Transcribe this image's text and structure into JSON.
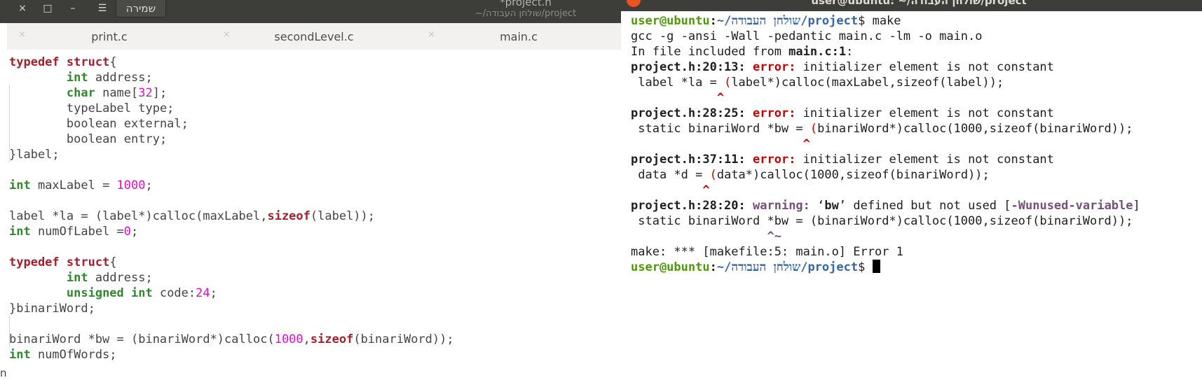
{
  "editor": {
    "title": "*project.h",
    "subtitle": "~/שולחן העבודה/project",
    "save_label": "שמירה",
    "close_icon": "×",
    "maximize_icon": "□",
    "minimize_icon": "–",
    "menu_icon": "☰",
    "tabs": [
      {
        "label": "print.c",
        "close": "×"
      },
      {
        "label": "secondLevel.c",
        "close": "×"
      },
      {
        "label": "main.c",
        "close": "×"
      }
    ],
    "code": {
      "l1_kw": "typedef",
      "l1_kw2": "struct",
      "l1_rest": "{",
      "l2_ty": "int",
      "l2_rest": " address;",
      "l3_ty": "char",
      "l3_rest": " name[",
      "l3_num": "32",
      "l3_end": "];",
      "l4": "typeLabel type;",
      "l5": "boolean external;",
      "l6": "boolean entry;",
      "l7": "}label;",
      "l9_ty": "int",
      "l9_rest": " maxLabel = ",
      "l9_num": "1000",
      "l9_end": ";",
      "l11_a": "label *la = (label*)calloc(maxLabel,",
      "l11_kw": "sizeof",
      "l11_b": "(label));",
      "l12_ty": "int",
      "l12_rest": " numOfLabel =",
      "l12_num": "0",
      "l12_end": ";",
      "l14_kw": "typedef",
      "l14_kw2": "struct",
      "l14_rest": "{",
      "l15_ty": "int",
      "l15_rest": " address;",
      "l16_ty": "unsigned int",
      "l16_rest": " code:",
      "l16_num": "24",
      "l16_end": ";",
      "l17": "}binariWord;",
      "l19_a": "binariWord *bw = (binariWord*)calloc(",
      "l19_num": "1000",
      "l19_mid": ",",
      "l19_kw": "sizeof",
      "l19_b": "(binariWord));",
      "l20_ty": "int",
      "l20_rest": " numOfWords;"
    },
    "status_char": "n"
  },
  "terminal": {
    "title": "user@ubuntu: ~/שולחן העבודה/project",
    "prompt_user": "user@ubuntu",
    "prompt_sep": ":",
    "prompt_path": "~/שולחן העבודה/project",
    "prompt_end": "$ ",
    "cmd": "make",
    "gcc": "gcc -g -ansi -Wall -pedantic main.c -lm -o main.o",
    "incl_a": "In file included from ",
    "incl_b": "main.c:1",
    "incl_c": ":",
    "e1_loc": "project.h:20:13:",
    "e1_kind": "error:",
    "e1_msg": " initializer element is not constant",
    "e1_src_a": " label *la = ",
    "e1_src_paren": "(",
    "e1_src_b": "label*)calloc(maxLabel,sizeof(label));",
    "e1_caret": "^",
    "e2_loc": "project.h:28:25:",
    "e2_kind": "error:",
    "e2_msg": " initializer element is not constant",
    "e2_src_a": " static binariWord *bw = ",
    "e2_src_paren": "(",
    "e2_src_b": "binariWord*)calloc(1000,sizeof(binariWord));",
    "e2_caret": "^",
    "e3_loc": "project.h:37:11:",
    "e3_kind": "error:",
    "e3_msg": " initializer element is not constant",
    "e3_src_a": " data *d = ",
    "e3_src_paren": "(",
    "e3_src_b": "data*)calloc(1000,sizeof(binariWord));",
    "e3_caret": "^",
    "w1_loc": "project.h:28:20:",
    "w1_kind": "warning:",
    "w1_msg_a": " ‘",
    "w1_msg_b": "bw",
    "w1_msg_c": "’ defined but not used [",
    "w1_flag": "-Wunused-variable",
    "w1_msg_d": "]",
    "w1_src": " static binariWord *bw = (binariWord*)calloc(1000,sizeof(binariWord));",
    "w1_caret": "^~",
    "make_err": "make: *** [makefile:5: main.o] Error 1"
  }
}
